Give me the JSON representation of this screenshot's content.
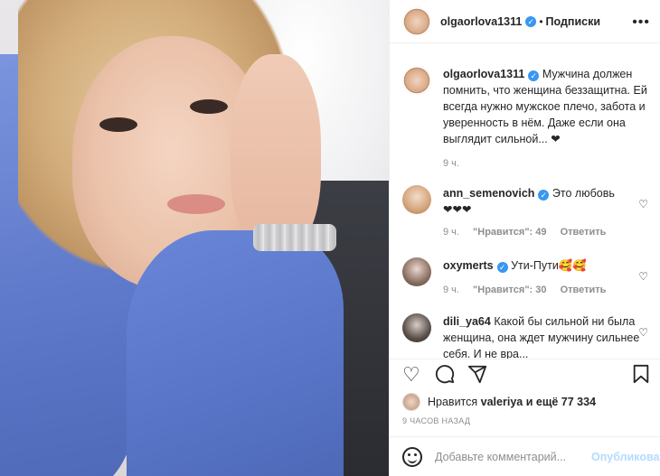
{
  "post": {
    "author": "olgaorlova1311",
    "separator": "•",
    "follow_label": "Подписки",
    "more_icon": "more-icon",
    "caption": "Мужчина должен помнить, что женщина беззащитна. Ей всегда нужно мужское плечо, забота и уверенность в нём. Даже если она выглядит сильной... ❤",
    "caption_time": "9 ч."
  },
  "comments": [
    {
      "user": "ann_semenovich",
      "verified": true,
      "text": "Это любовь",
      "text2": "❤❤❤",
      "time": "9 ч.",
      "likes": "\"Нравится\": 49",
      "reply": "Ответить"
    },
    {
      "user": "oxymerts",
      "verified": true,
      "text": "Ути-Пути🥰🥰",
      "time": "9 ч.",
      "likes": "\"Нравится\": 30",
      "reply": "Ответить"
    },
    {
      "user": "dili_ya64",
      "verified": false,
      "text": "Какой бы сильной ни была женщина, она ждет мужчину сильнее себя. И не вра..."
    }
  ],
  "likes_line": {
    "prefix": "Нравится",
    "user": "valeriya",
    "suffix": "и ещё 77 334"
  },
  "timestamp": "9 ЧАСОВ НАЗАД",
  "comment_box": {
    "placeholder": "Добавьте комментарий...",
    "publish_label": "Опубликовать"
  },
  "colors": {
    "verified": "#3897f0",
    "publish_disabled": "#b3dbff",
    "meta_gray": "#8e8e8e"
  }
}
